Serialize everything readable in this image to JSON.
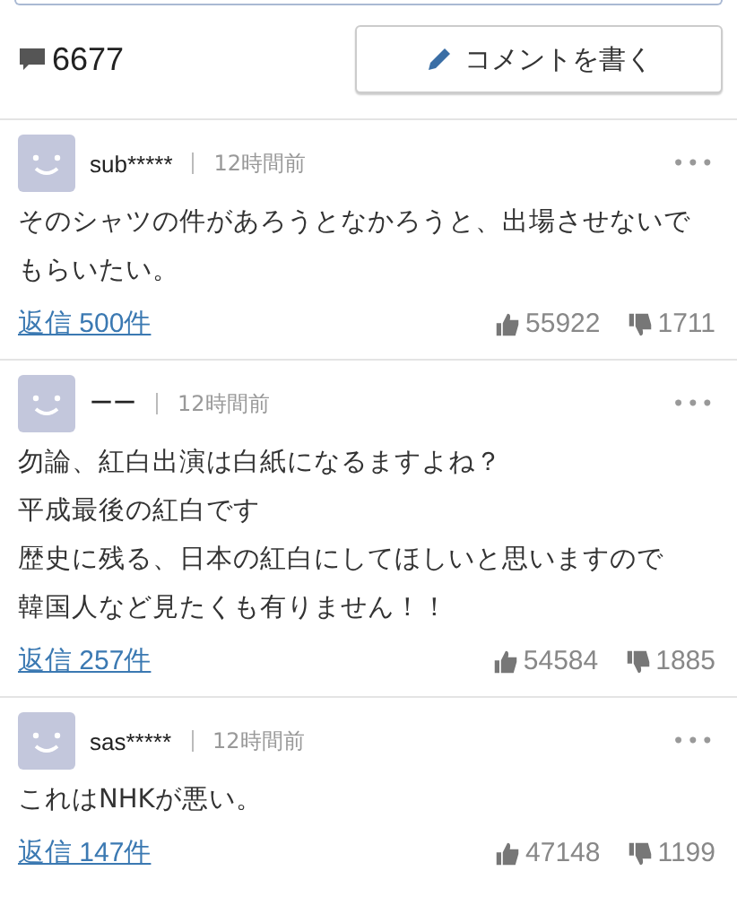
{
  "comment_count": "6677",
  "write_button": "コメントを書く",
  "comments": [
    {
      "user": "sub*****",
      "time": "12時間前",
      "menu": "•••",
      "text": [
        "そのシャツの件があろうとなかろうと、出場させないでもらいたい。"
      ],
      "replies": "返信 500件",
      "likes": "55922",
      "dislikes": "1711"
    },
    {
      "user": "ーー",
      "time": "12時間前",
      "menu": "•••",
      "text": [
        "勿論、紅白出演は白紙になるますよね？",
        "平成最後の紅白です",
        "歴史に残る、日本の紅白にしてほしいと思いますので",
        "韓国人など見たくも有りません！！"
      ],
      "replies": "返信 257件",
      "likes": "54584",
      "dislikes": "1885"
    },
    {
      "user": "sas*****",
      "time": "12時間前",
      "menu": "•••",
      "text": [
        "これはNHKが悪い。"
      ],
      "replies": "返信 147件",
      "likes": "47148",
      "dislikes": "1199"
    }
  ]
}
